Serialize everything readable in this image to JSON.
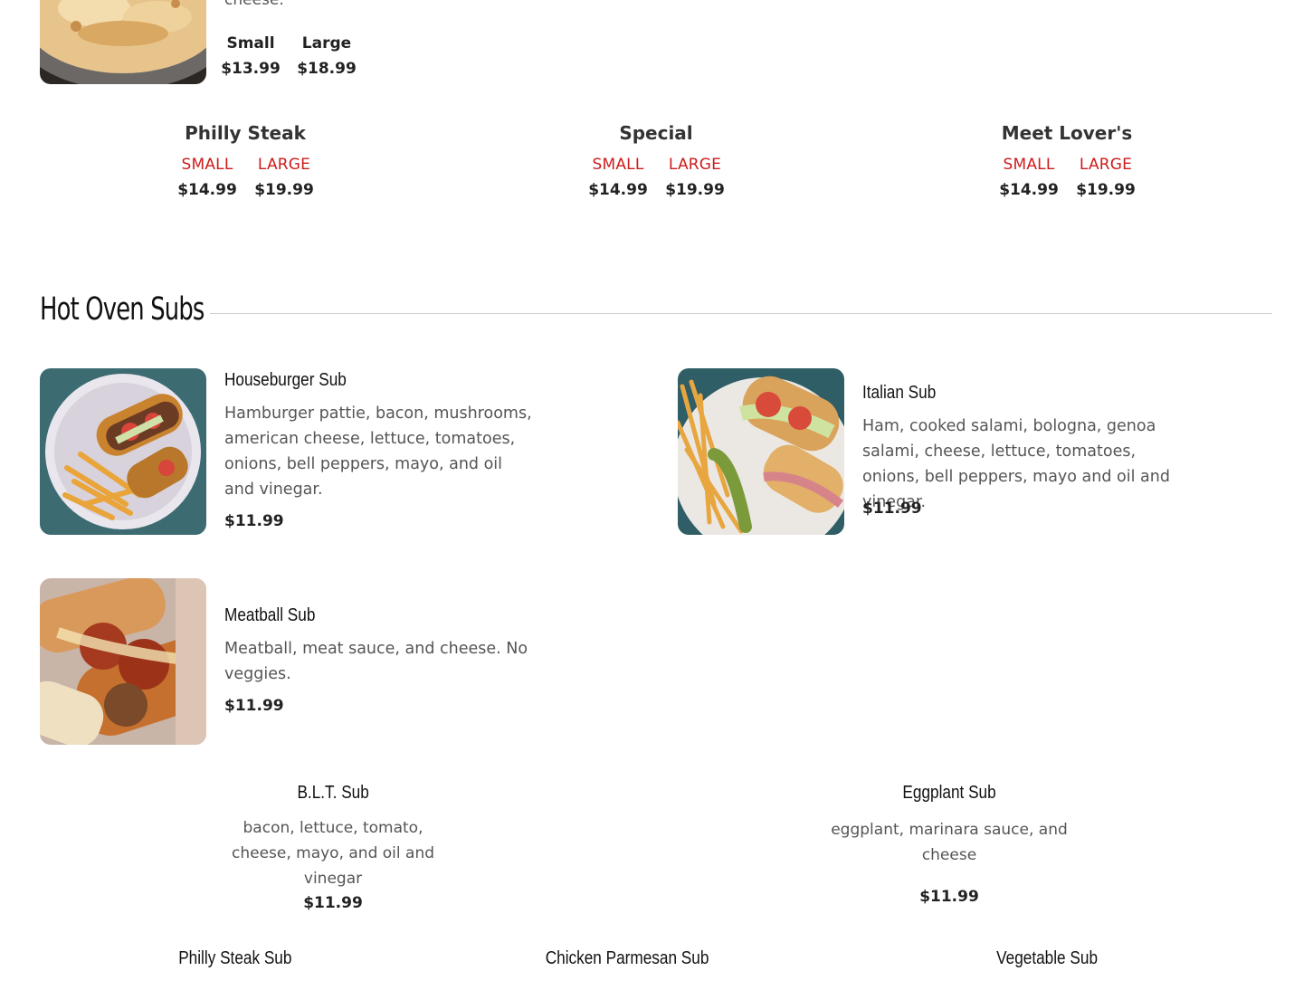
{
  "pizza_cut": {
    "desc_fragment": "cheese.",
    "sizes": [
      {
        "label": "Small",
        "price": "$13.99"
      },
      {
        "label": "Large",
        "price": "$18.99"
      }
    ]
  },
  "specialty_pizzas": [
    {
      "name": "Philly Steak",
      "small_label": "SMALL",
      "large_label": "LARGE",
      "small_price": "$14.99",
      "large_price": "$19.99"
    },
    {
      "name": "Special",
      "small_label": "SMALL",
      "large_label": "LARGE",
      "small_price": "$14.99",
      "large_price": "$19.99"
    },
    {
      "name": "Meet Lover's",
      "small_label": "SMALL",
      "large_label": "LARGE",
      "small_price": "$14.99",
      "large_price": "$19.99"
    }
  ],
  "hot_oven_subs": {
    "title": "Hot Oven Subs",
    "featured": [
      {
        "name": "Houseburger Sub",
        "desc": "Hamburger pattie, bacon, mushrooms, american cheese, lettuce, tomatoes, onions, bell peppers, mayo, and oil and vinegar.",
        "price": "$11.99"
      },
      {
        "name": "Italian Sub",
        "desc": "Ham, cooked salami, bologna, genoa salami, cheese, lettuce, tomatoes, onions, bell peppers, mayo and oil and vinegar.",
        "price": "$11.99"
      },
      {
        "name": "Meatball Sub",
        "desc": "Meatball, meat sauce, and cheese. No veggies.",
        "price": "$11.99"
      }
    ],
    "plain": [
      {
        "name": "B.L.T. Sub",
        "desc": "bacon, lettuce, tomato, cheese, mayo, and oil and vinegar",
        "price": "$11.99"
      },
      {
        "name": "Eggplant Sub",
        "desc": "eggplant, marinara sauce, and cheese",
        "price": "$11.99"
      }
    ],
    "bottom_row": [
      {
        "name": "Philly Steak Sub"
      },
      {
        "name": "Chicken Parmesan Sub"
      },
      {
        "name": "Vegetable Sub"
      }
    ]
  }
}
